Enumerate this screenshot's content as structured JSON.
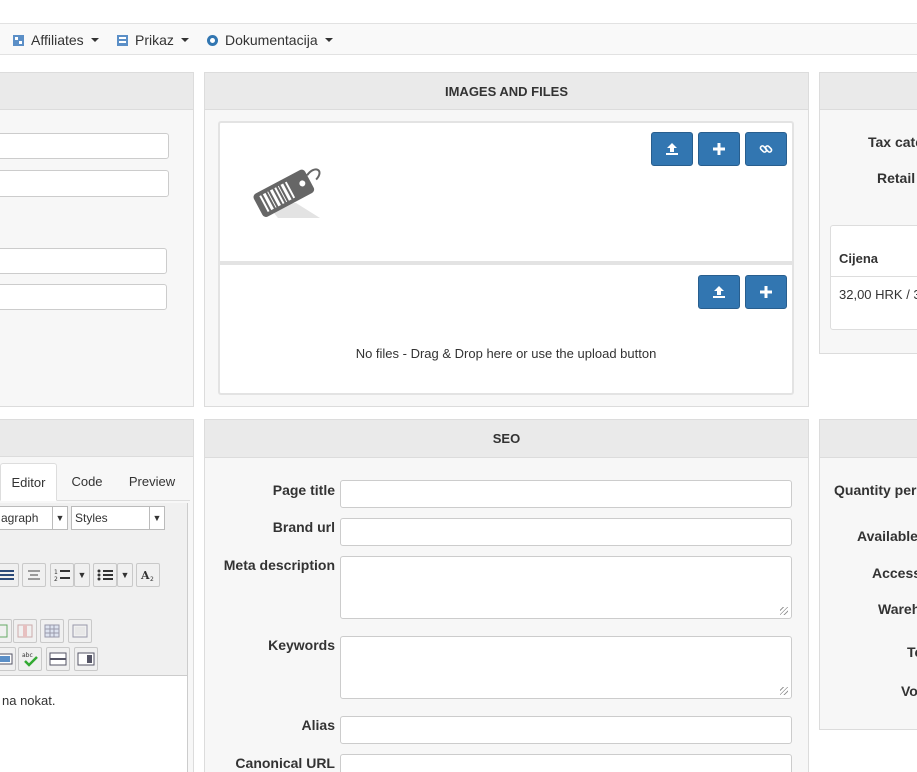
{
  "menu": {
    "items": [
      {
        "label": "Affiliates"
      },
      {
        "label": "Prikaz"
      },
      {
        "label": "Dokumentacija"
      }
    ]
  },
  "images_panel": {
    "title": "IMAGES AND FILES",
    "files_empty_text": "No files - Drag & Drop here or use the upload button"
  },
  "right_top_panel": {
    "tax_label": "Tax cate",
    "retail_label": "Retail",
    "price_header": "Cijena",
    "price_value": "32,00 HRK / 3"
  },
  "editor_panel": {
    "tabs": [
      "Editor",
      "Code",
      "Preview"
    ],
    "format_select": "agraph",
    "styles_select": "Styles",
    "content_text": "na nokat."
  },
  "seo_panel": {
    "title": "SEO",
    "labels": {
      "page_title": "Page title",
      "brand_url": "Brand url",
      "meta_description": "Meta description",
      "keywords": "Keywords",
      "alias": "Alias",
      "canonical_url": "Canonical URL"
    }
  },
  "right_bottom_panel": {
    "quantity_label": "Quantity per",
    "available_label": "Available",
    "access_label": "Access",
    "warehouse_label": "Wareh",
    "t_label": "Te",
    "v_label": "Vo"
  },
  "colors": {
    "button_blue": "#3276b1",
    "panel_header": "#eaeaea"
  }
}
